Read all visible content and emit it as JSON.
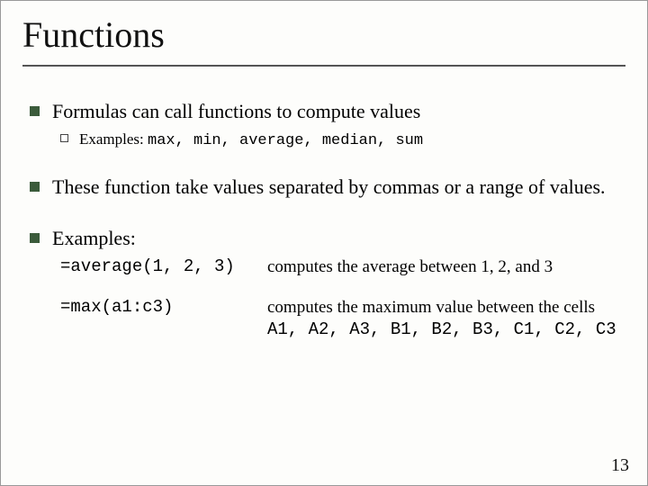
{
  "title": "Functions",
  "bullets": {
    "b1": "Formulas can call functions to compute values",
    "b1_sub_prefix": "Examples: ",
    "b1_sub_mono": "max, min, average, median, sum",
    "b2": "These function take values separated by commas or a range of values.",
    "b3": "Examples:"
  },
  "examples": {
    "e1": {
      "formula": "=average(1, 2, 3)",
      "desc": "computes the average between 1, 2, and 3"
    },
    "e2": {
      "formula": "=max(a1:c3)",
      "desc_prefix": "computes the maximum value between the cells ",
      "cells": "A1, A2, A3, B1, B2, B3, C1, C2, C3"
    }
  },
  "page_number": "13"
}
